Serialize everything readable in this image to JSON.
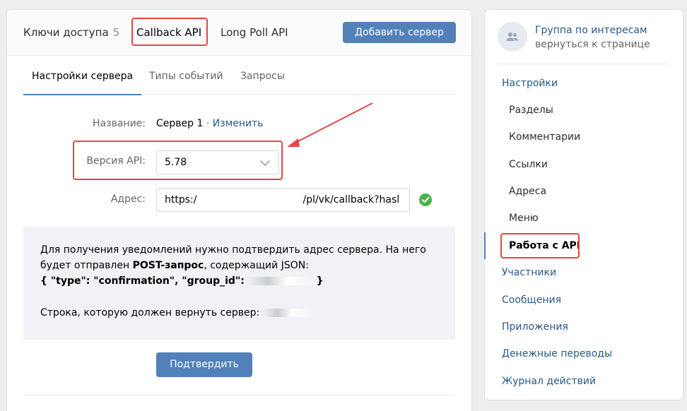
{
  "top_tabs": {
    "access_keys": {
      "label": "Ключи доступа",
      "count": "5"
    },
    "callback_api": {
      "label": "Callback API"
    },
    "long_poll_api": {
      "label": "Long Poll API"
    },
    "add_server": "Добавить сервер"
  },
  "sub_tabs": {
    "server_settings": "Настройки сервера",
    "event_types": "Типы событий",
    "requests": "Запросы"
  },
  "form": {
    "name_label": "Название:",
    "name_value": "Сервер 1",
    "name_sep": " · ",
    "edit_link": "Изменить",
    "api_version_label": "Версия API:",
    "api_version_value": "5.78",
    "address_label": "Адрес:",
    "address_prefix": "https:/",
    "address_suffix": "/pl/vk/callback?hasl"
  },
  "info": {
    "line1": "Для получения уведомлений нужно подтвердить адрес сервера. На него",
    "line2_pre": "будет отправлен ",
    "line2_bold": "POST-запрос",
    "line2_post": ", содержащий JSON:",
    "line3": "{ \"type\": \"confirmation\", \"group_id\": ",
    "line3_end": " }",
    "line4": "Строка, которую должен вернуть сервер: "
  },
  "confirm_button": "Подтвердить",
  "sidebar": {
    "group_title": "Группа по интересам",
    "back_link": "вернуться к странице",
    "items": [
      {
        "label": "Настройки"
      },
      {
        "label": "Разделы"
      },
      {
        "label": "Комментарии"
      },
      {
        "label": "Ссылки"
      },
      {
        "label": "Адреса"
      },
      {
        "label": "Меню"
      },
      {
        "label": "Работа с API"
      },
      {
        "label": "Участники"
      },
      {
        "label": "Сообщения"
      },
      {
        "label": "Приложения"
      },
      {
        "label": "Денежные переводы"
      },
      {
        "label": "Журнал действий"
      }
    ]
  },
  "colors": {
    "accent": "#5181b8",
    "link": "#2a5885",
    "highlight": "#e64646",
    "success": "#4bb34b"
  },
  "icons": [
    "chevron-down-icon",
    "check-circle-icon",
    "group-avatar-icon",
    "annotation-arrow"
  ]
}
